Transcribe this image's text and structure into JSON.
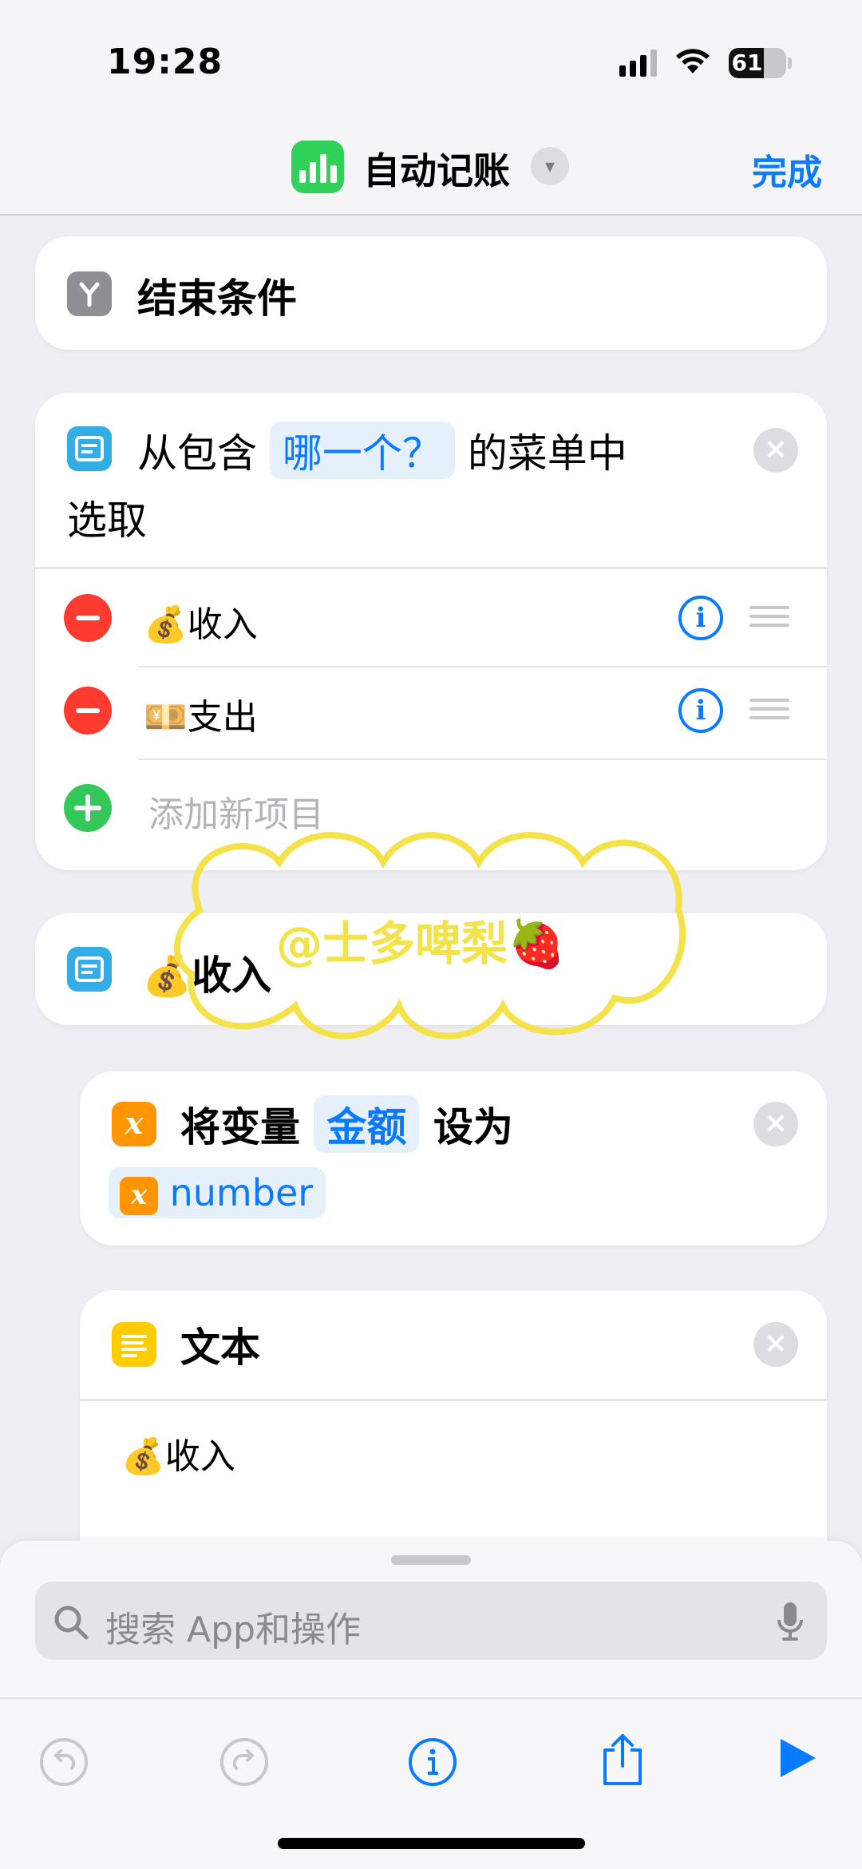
{
  "status_bar": {
    "time": "19:28",
    "battery_percent": "61",
    "battery_level": 0.61
  },
  "nav": {
    "title": "自动记账",
    "done_label": "完成",
    "chevron_icon": "chevron-down-icon"
  },
  "end_condition": {
    "label": "结束条件"
  },
  "choose_menu": {
    "prefix": "从包含",
    "token": "哪一个？",
    "middle": "的菜单中",
    "suffix": "选取",
    "items": [
      {
        "emoji": "💰",
        "label": "收入"
      },
      {
        "emoji": "💴",
        "label": "支出"
      }
    ],
    "add_placeholder": "添加新项目"
  },
  "menu_case": {
    "emoji": "💰",
    "label": "收入"
  },
  "set_variable": {
    "prefix": "将变量",
    "variable": "金额",
    "middle": "设为",
    "value_icon": "x",
    "value": "number"
  },
  "text_action": {
    "title": "文本",
    "emoji": "💰",
    "content": "收入"
  },
  "watermark": "@士多啤梨🍓",
  "search": {
    "placeholder": "搜索 App和操作"
  },
  "colors": {
    "accent": "#0a7aff",
    "destructive": "#ff3b30",
    "add": "#34c759",
    "watermark": "#f4e24a"
  }
}
